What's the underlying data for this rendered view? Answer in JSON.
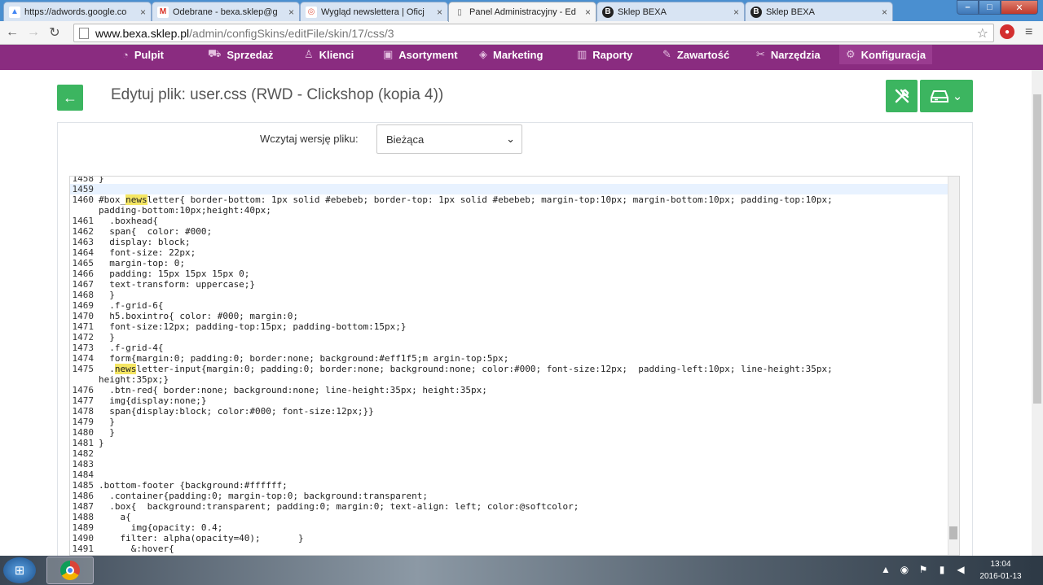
{
  "browser": {
    "tabs": [
      {
        "title": "https://adwords.google.co",
        "icon": "adwords-icon",
        "active": false
      },
      {
        "title": "Odebrane - bexa.sklep@g",
        "icon": "gmail-icon",
        "active": false
      },
      {
        "title": "Wygląd newslettera | Oficj",
        "icon": "lifebuoy-icon",
        "active": false
      },
      {
        "title": "Panel Administracyjny - Ed",
        "icon": "page-icon",
        "active": true
      },
      {
        "title": "Sklep BEXA",
        "icon": "bexa-icon",
        "active": false
      },
      {
        "title": "Sklep BEXA",
        "icon": "bexa-icon",
        "active": false
      }
    ],
    "url_host": "www.bexa.sklep.pl",
    "url_path": "/admin/configSkins/editFile/skin/17/css/3"
  },
  "admin_nav": [
    {
      "label": "Pulpit",
      "icon": "gauge-icon"
    },
    {
      "label": "Sprzedaż",
      "icon": "cart-icon"
    },
    {
      "label": "Klienci",
      "icon": "user-icon"
    },
    {
      "label": "Asortyment",
      "icon": "box-icon"
    },
    {
      "label": "Marketing",
      "icon": "tag-icon"
    },
    {
      "label": "Raporty",
      "icon": "bar-chart-icon"
    },
    {
      "label": "Zawartość",
      "icon": "edit-icon"
    },
    {
      "label": "Narzędzia",
      "icon": "tools-icon"
    },
    {
      "label": "Konfiguracja",
      "icon": "gear-icon"
    }
  ],
  "page": {
    "title": "Edytuj plik: user.css (RWD - Clickshop (kopia 4))",
    "version_label": "Wczytaj wersję pliku:",
    "version_value": "Bieżąca"
  },
  "editor": {
    "lines": [
      {
        "n": "1458",
        "t": "}"
      },
      {
        "n": "1459",
        "t": ""
      },
      {
        "n": "1460",
        "t": "#box_newsletter{ border-bottom: 1px solid #ebebeb; border-top: 1px solid #ebebeb; margin-top:10px; margin-bottom:10px; padding-top:10px;"
      },
      {
        "n": "",
        "t": "padding-bottom:10px;height:40px;"
      },
      {
        "n": "1461",
        "t": "  .boxhead{"
      },
      {
        "n": "1462",
        "t": "  span{  color: #000;"
      },
      {
        "n": "1463",
        "t": "  display: block;"
      },
      {
        "n": "1464",
        "t": "  font-size: 22px;"
      },
      {
        "n": "1465",
        "t": "  margin-top: 0;"
      },
      {
        "n": "1466",
        "t": "  padding: 15px 15px 15px 0;"
      },
      {
        "n": "1467",
        "t": "  text-transform: uppercase;}"
      },
      {
        "n": "1468",
        "t": "  }"
      },
      {
        "n": "1469",
        "t": "  .f-grid-6{"
      },
      {
        "n": "1470",
        "t": "  h5.boxintro{ color: #000; margin:0;"
      },
      {
        "n": "1471",
        "t": "  font-size:12px; padding-top:15px; padding-bottom:15px;}"
      },
      {
        "n": "1472",
        "t": "  }"
      },
      {
        "n": "1473",
        "t": "  .f-grid-4{"
      },
      {
        "n": "1474",
        "t": "  form{margin:0; padding:0; border:none; background:#eff1f5;m argin-top:5px;"
      },
      {
        "n": "1475",
        "t": "  .newsletter-input{margin:0; padding:0; border:none; background:none; color:#000; font-size:12px;  padding-left:10px; line-height:35px;"
      },
      {
        "n": "",
        "t": "height:35px;}"
      },
      {
        "n": "1476",
        "t": "  .btn-red{ border:none; background:none; line-height:35px; height:35px;"
      },
      {
        "n": "1477",
        "t": "  img{display:none;}"
      },
      {
        "n": "1478",
        "t": "  span{display:block; color:#000; font-size:12px;}}"
      },
      {
        "n": "1479",
        "t": "  }"
      },
      {
        "n": "1480",
        "t": "  }"
      },
      {
        "n": "1481",
        "t": "}"
      },
      {
        "n": "1482",
        "t": ""
      },
      {
        "n": "1483",
        "t": ""
      },
      {
        "n": "1484",
        "t": ""
      },
      {
        "n": "1485",
        "t": ".bottom-footer {background:#ffffff;"
      },
      {
        "n": "1486",
        "t": "  .container{padding:0; margin-top:0; background:transparent;"
      },
      {
        "n": "1487",
        "t": "  .box{  background:transparent; padding:0; margin:0; text-align: left; color:@softcolor;"
      },
      {
        "n": "1488",
        "t": "    a{"
      },
      {
        "n": "1489",
        "t": "      img{opacity: 0.4;"
      },
      {
        "n": "1490",
        "t": "    filter: alpha(opacity=40);       }"
      },
      {
        "n": "1491",
        "t": "      &:hover{"
      }
    ],
    "current_line": 1,
    "highlight": "news"
  },
  "taskbar": {
    "time": "13:04",
    "date": "2016-01-13"
  }
}
